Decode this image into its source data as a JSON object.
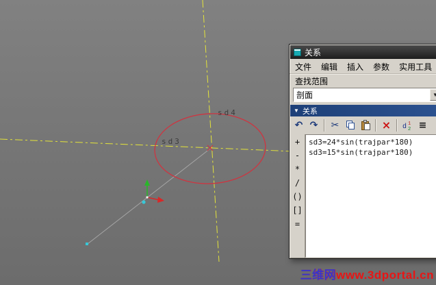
{
  "colors": {
    "centerline": "#e4e43a",
    "sketch": "#cf3440",
    "header": "#1e4078",
    "wm_cn": "#3a35c8",
    "wm_url": "#e81515",
    "triad_green": "#28b828",
    "triad_red": "#d82828",
    "point": "#38c8d8"
  },
  "viewport": {
    "labels": {
      "sd4": "sd4",
      "sd3": "sd3"
    },
    "watermark": {
      "site": "三维网",
      "url": "www.3dportal.cn"
    }
  },
  "dialog": {
    "title": "关系",
    "menu": [
      "文件",
      "编辑",
      "插入",
      "参数",
      "实用工具"
    ],
    "find_scope_label": "查找范围",
    "find_scope_value": "剖面",
    "combo_arrow": "▼",
    "section_header_arrow": "▼",
    "section_header": "关系",
    "icons": {
      "undo": "↶",
      "redo": "↷",
      "cut": "✂",
      "delete": "×",
      "list": "≡"
    },
    "operators": [
      "+",
      "-",
      "*",
      "/",
      "()",
      "[]",
      "="
    ],
    "equations": [
      "sd3=24*sin(trajpar*180)",
      "sd3=15*sin(trajpar*180)"
    ]
  }
}
